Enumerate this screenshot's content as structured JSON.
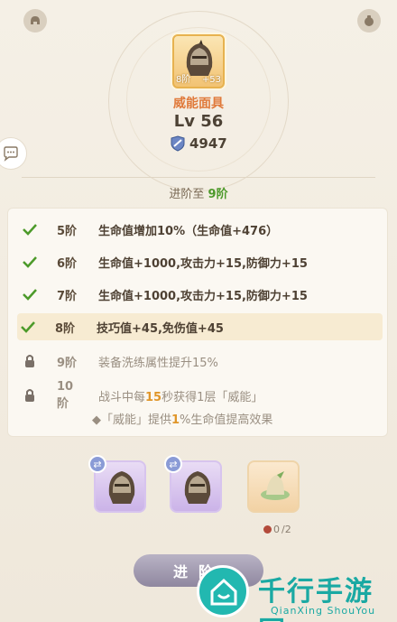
{
  "item": {
    "tier": "8阶",
    "plus": "+53",
    "name": "威能面具",
    "level": "Lv 56",
    "power": "4947"
  },
  "advance": {
    "prefix": "进阶至",
    "target": "9阶"
  },
  "tiers": [
    {
      "label": "5阶",
      "desc": "生命值增加10%（生命值+476）",
      "status": "unlocked"
    },
    {
      "label": "6阶",
      "desc": "生命值+1000,攻击力+15,防御力+15",
      "status": "unlocked"
    },
    {
      "label": "7阶",
      "desc": "生命值+1000,攻击力+15,防御力+15",
      "status": "unlocked"
    },
    {
      "label": "8阶",
      "desc": "技巧值+45,免伤值+45",
      "status": "current"
    },
    {
      "label": "9阶",
      "desc": "装备洗练属性提升15%",
      "status": "locked"
    },
    {
      "label": "10阶",
      "desc_a": "战斗中每",
      "desc_num": "15",
      "desc_b": "秒获得1层「威能」",
      "status": "locked"
    }
  ],
  "tier10_sub": {
    "a": "◆「威能」提供",
    "num": "1",
    "b": "%生命值提高效果"
  },
  "materials": {
    "count_have": "0",
    "count_need": "/2"
  },
  "button": {
    "label": "进阶"
  },
  "watermark": {
    "title": "千行手游网",
    "subtitle": "QianXing ShouYou"
  },
  "colors": {
    "accent_orange": "#e07a3b",
    "check_green": "#4c9a2a",
    "highlight_row": "#f7ebd2",
    "button_gray": "#8f879f",
    "watermark_teal": "#1aa9a3"
  },
  "icons": [
    "helmet-icon",
    "shield-icon",
    "check-icon",
    "lock-icon",
    "swap-icon",
    "chat-icon",
    "bag-icon"
  ]
}
